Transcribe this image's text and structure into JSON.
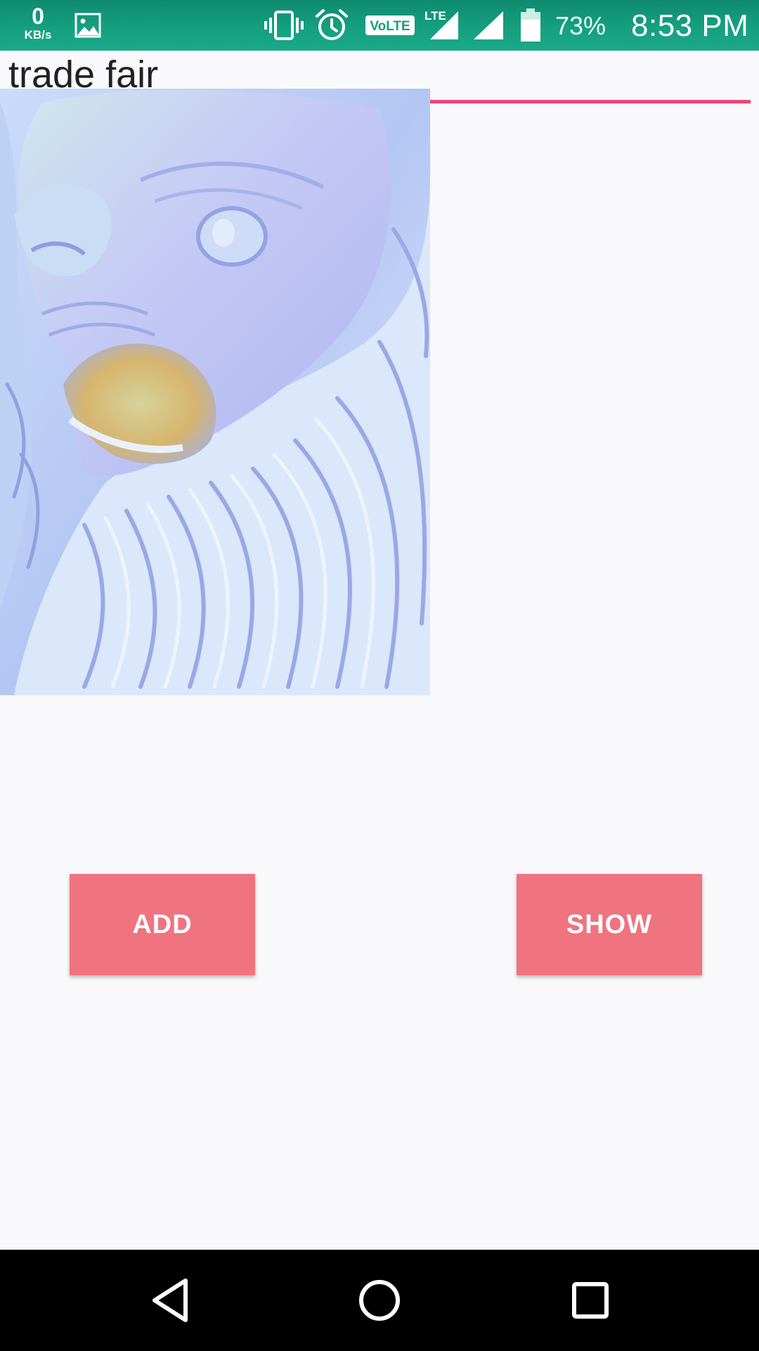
{
  "status_bar": {
    "net_speed_value": "0",
    "net_speed_unit": "KB/s",
    "battery_percent": "73%",
    "time": "8:53 PM",
    "icons": [
      "gallery-notification-icon",
      "vibrate-icon",
      "alarm-icon",
      "volte-icon",
      "lte-signal-icon",
      "signal-icon",
      "battery-icon"
    ],
    "volte_label": "VoLTE",
    "lte_label": "LTE",
    "background_color": "#15a07f"
  },
  "form": {
    "text_value": "trade fair",
    "underline_color": "#f0437a"
  },
  "photo": {
    "subject_icon": "lion-statue-photo"
  },
  "buttons": {
    "add_label": "ADD",
    "show_label": "SHOW",
    "color": "#f07380"
  },
  "nav_bar": {
    "icons": [
      "back-icon",
      "home-icon",
      "recents-icon"
    ]
  }
}
